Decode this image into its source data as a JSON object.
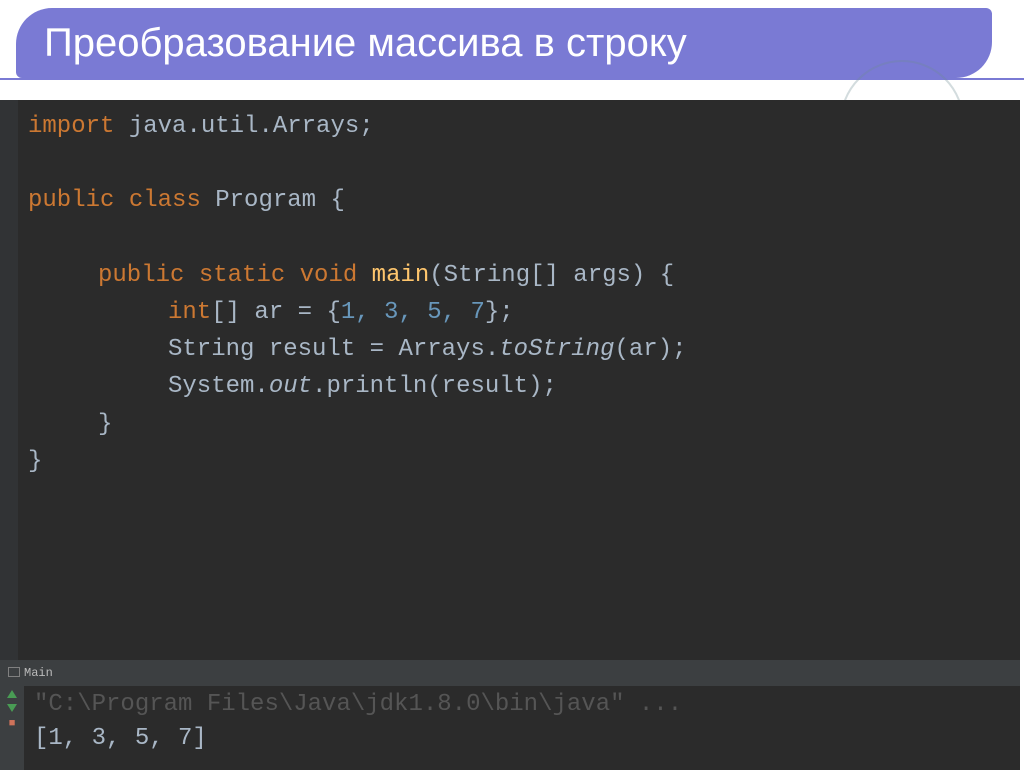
{
  "title": "Преобразование массива в строку",
  "code": {
    "import_kw": "import",
    "import_pkg": "java.util.Arrays;",
    "public_kw": "public",
    "class_kw": "class",
    "class_name": "Program",
    "static_kw": "static",
    "void_kw": "void",
    "main_mth": "main",
    "main_params": "(String[] args) {",
    "int_kw": "int",
    "arr_decl": "[] ar = {",
    "arr_vals": "1, 3, 5, 7",
    "arr_end": "};",
    "str_line_a": "String result = Arrays.",
    "tostring": "toString",
    "str_line_b": "(ar);",
    "sys": "System.",
    "out": "out",
    "println": ".println(result);"
  },
  "console": {
    "tab_label": "Main",
    "path": "\"C:\\Program Files\\Java\\jdk1.8.0\\bin\\java\" ...",
    "output": "[1, 3, 5, 7]"
  },
  "chart_data": {
    "type": "table",
    "title": "Преобразование массива в строку",
    "description": "Java code example converting int array to String using Arrays.toString",
    "input_array": [
      1,
      3,
      5,
      7
    ],
    "output_string": "[1, 3, 5, 7]",
    "method": "Arrays.toString"
  }
}
